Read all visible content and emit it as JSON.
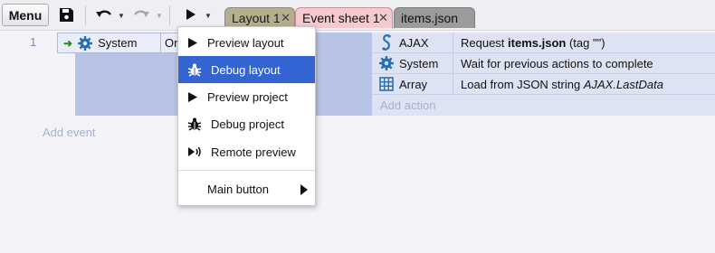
{
  "toolbar": {
    "menu_label": "Menu",
    "icons": [
      "save-icon",
      "undo-icon",
      "redo-icon",
      "play-icon"
    ]
  },
  "tabs": [
    {
      "label": "Layout 1",
      "color": "#b7ae8f"
    },
    {
      "label": "Event sheet 1",
      "color": "#f6c8cf"
    },
    {
      "label": "items.json",
      "color": "#9b9b9b"
    }
  ],
  "event": {
    "row_number": "1",
    "condition_object": "System",
    "condition_text": "On",
    "actions": [
      {
        "object": "AJAX",
        "icon": "ajax-icon",
        "text_prefix": "Request ",
        "text_bold": "items.json",
        "text_suffix": " (tag \"\")"
      },
      {
        "object": "System",
        "icon": "gear-icon",
        "text": "Wait for previous actions to complete"
      },
      {
        "object": "Array",
        "icon": "array-icon",
        "text_prefix": "Load from JSON string ",
        "text_italic": "AJAX.LastData"
      }
    ],
    "add_action": "Add action",
    "add_event": "Add event"
  },
  "dropdown": {
    "items": [
      {
        "label": "Preview layout",
        "icon": "play-icon"
      },
      {
        "label": "Debug layout",
        "icon": "bug-icon",
        "active": true
      },
      {
        "label": "Preview project",
        "icon": "play-icon"
      },
      {
        "label": "Debug project",
        "icon": "bug-icon"
      },
      {
        "label": "Remote preview",
        "icon": "remote-preview-icon"
      }
    ],
    "main_button": "Main button"
  },
  "colors": {
    "accent": "#3464d1",
    "event_block": "#b7c4e5",
    "actions_bg": "#dde3f3",
    "add_text": "#a7b1cc"
  }
}
